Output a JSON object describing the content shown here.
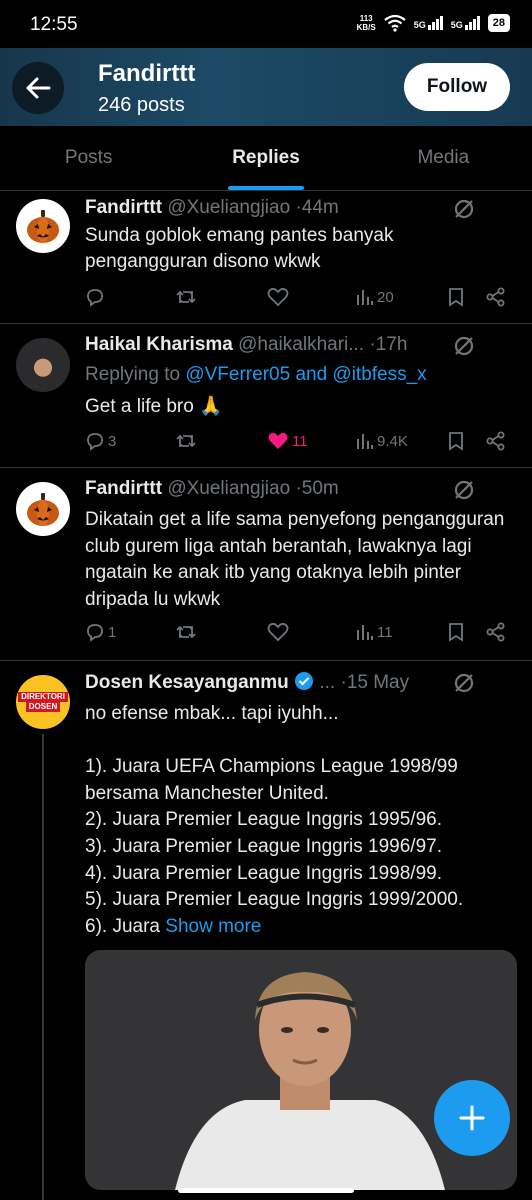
{
  "status_bar": {
    "time": "12:55",
    "net_speed_value": "113",
    "net_speed_unit": "KB/S",
    "signal1": "5G",
    "signal2": "5G",
    "battery": "28"
  },
  "header": {
    "name": "Fandirttt",
    "post_count": "246 posts",
    "follow_label": "Follow"
  },
  "tabs": [
    {
      "label": "Posts"
    },
    {
      "label": "Replies",
      "active": true
    },
    {
      "label": "Media"
    }
  ],
  "tweets": [
    {
      "author": "Fandirttt",
      "handle": "@Xueliangjiao",
      "dot": "·",
      "time": "44m",
      "text": "Sunda goblok emang pantes banyak pengangguran disono wkwk",
      "replies": "",
      "likes": "",
      "views": "20"
    },
    {
      "author": "Haikal Kharisma",
      "handle": "@haikalkhari...",
      "dot": "·",
      "time": "17h",
      "replying_prefix": "Replying to",
      "replying_to": "@VFerrer05 and @itbfess_x",
      "text": "Get a life bro 🙏",
      "replies": "3",
      "likes": "11",
      "views": "9.4K"
    },
    {
      "author": "Fandirttt",
      "handle": "@Xueliangjiao",
      "dot": "·",
      "time": "50m",
      "text": "Dikatain get a life sama penyefong pengangguran club gurem liga antah berantah, lawaknya lagi ngatain ke anak itb yang otaknya lebih pinter dripada lu wkwk",
      "replies": "1",
      "likes": "",
      "views": "11"
    },
    {
      "author": "Dosen Kesayanganmu",
      "handle": "...",
      "dot": "·",
      "time": "15 May",
      "logo_text": [
        "DIREKTORI",
        "DOSEN"
      ],
      "lines": [
        "no efense mbak... tapi iyuhh...",
        "",
        "1). Juara UEFA Champions League 1998/99",
        "bersama Manchester United.",
        "2). Juara Premier League Inggris 1995/96.",
        "3). Juara Premier League Inggris 1996/97.",
        "4). Juara Premier League Inggris 1998/99.",
        "5). Juara Premier League Inggris 1999/2000."
      ],
      "last_line_prefix": "6). Juara",
      "show_more": "Show more"
    }
  ],
  "colors": {
    "accent": "#1d9bf0",
    "like": "#f91880",
    "header_bg": "#1c4a66"
  },
  "icons": [
    "back-arrow-icon",
    "grok-icon",
    "reply-icon",
    "retweet-icon",
    "heart-icon",
    "views-icon",
    "bookmark-icon",
    "share-icon",
    "verified-icon",
    "plus-icon"
  ]
}
